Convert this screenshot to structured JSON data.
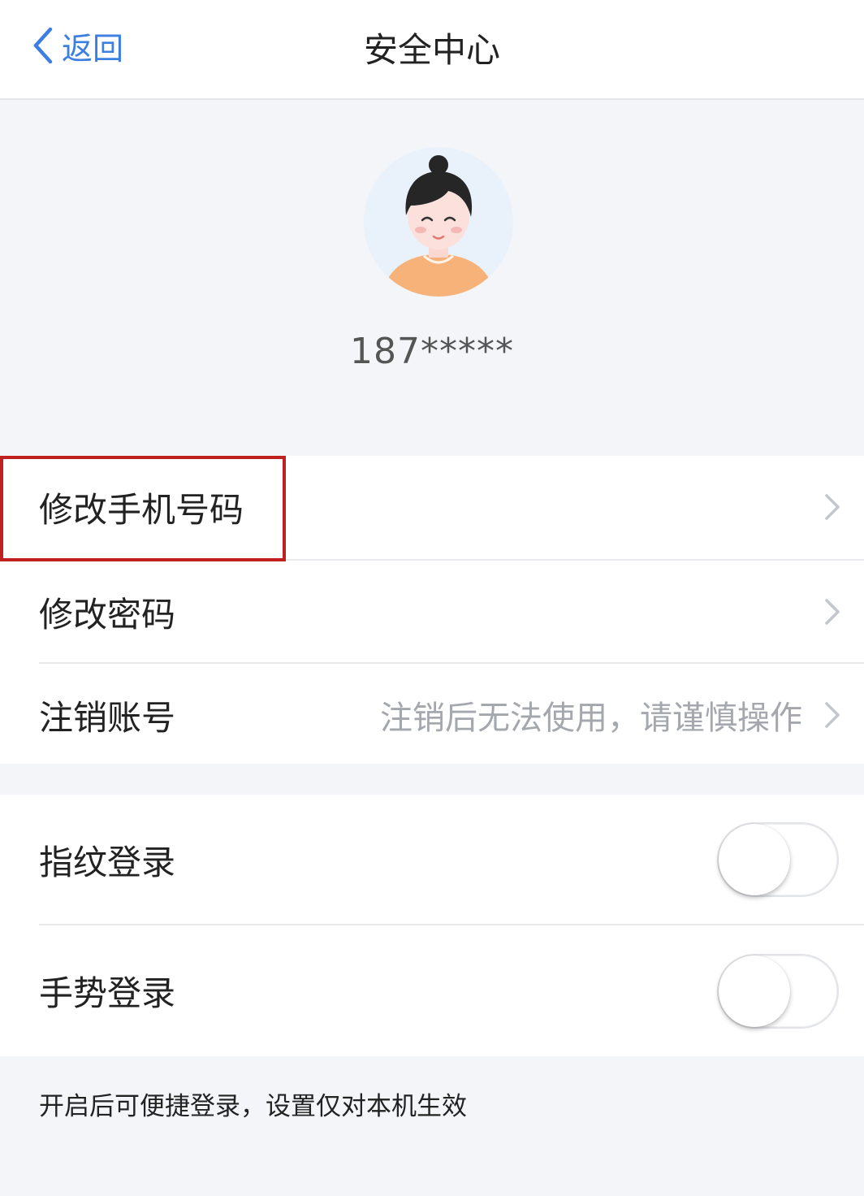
{
  "navbar": {
    "back_label": "返回",
    "title": "安全中心"
  },
  "profile": {
    "phone": "187*****"
  },
  "account_rows": [
    {
      "label": "修改手机号码",
      "hint": ""
    },
    {
      "label": "修改密码",
      "hint": ""
    },
    {
      "label": "注销账号",
      "hint": "注销后无法使用，请谨慎操作"
    }
  ],
  "login_rows": [
    {
      "label": "指纹登录",
      "enabled": false
    },
    {
      "label": "手势登录",
      "enabled": false
    }
  ],
  "footer_note": "开启后可便捷登录，设置仅对本机生效",
  "colors": {
    "accent": "#3b7fe0",
    "highlight_border": "#c0201e",
    "background": "#f3f5f9"
  },
  "icons": {
    "back": "chevron-left-icon",
    "row_arrow": "chevron-right-icon",
    "avatar": "user-avatar"
  }
}
